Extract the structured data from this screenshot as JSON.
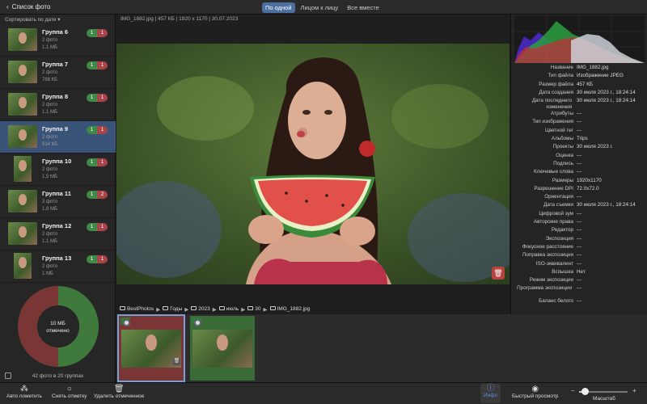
{
  "topbar": {
    "back_label": "Список фото",
    "view_modes": [
      {
        "label": "По одной",
        "active": true
      },
      {
        "label": "Лицом к лицу",
        "active": false
      },
      {
        "label": "Все вместе",
        "active": false
      }
    ]
  },
  "sidebar": {
    "sort_label": "Сортировать по дате",
    "groups": [
      {
        "name": "Группа 6",
        "count": "2 фото",
        "size": "1,1 МБ",
        "keep": "1",
        "discard": "1",
        "selected": false
      },
      {
        "name": "Группа 7",
        "count": "2 фото",
        "size": "768 КБ",
        "keep": "1",
        "discard": "1",
        "selected": false
      },
      {
        "name": "Группа 8",
        "count": "2 фото",
        "size": "1,1 МБ",
        "keep": "1",
        "discard": "1",
        "selected": false
      },
      {
        "name": "Группа 9",
        "count": "2 фото",
        "size": "914 КБ",
        "keep": "1",
        "discard": "1",
        "selected": true
      },
      {
        "name": "Группа 10",
        "count": "2 фото",
        "size": "1,5 МБ",
        "keep": "1",
        "discard": "1",
        "selected": false
      },
      {
        "name": "Группа 11",
        "count": "3 фото",
        "size": "1,8 МБ",
        "keep": "1",
        "discard": "2",
        "selected": false
      },
      {
        "name": "Группа 12",
        "count": "2 фото",
        "size": "1,1 МБ",
        "keep": "1",
        "discard": "1",
        "selected": false
      },
      {
        "name": "Группа 13",
        "count": "2 фото",
        "size": "1 МБ",
        "keep": "1",
        "discard": "1",
        "selected": false
      }
    ],
    "donut": {
      "marked_size": "10 МБ",
      "marked_label": "отмечено",
      "marked_fraction": 0.5,
      "colors": {
        "marked": "#7a3535",
        "kept": "#3f7a3c"
      }
    },
    "summary": "42 фото в 20 группах"
  },
  "viewer": {
    "fileinfo": "IMG_1882.jpg | 457 КБ | 1920 x 1170 | 30.07.2023"
  },
  "breadcrumb": [
    "BestPhotos",
    "Годы",
    "2023",
    "июль",
    "30",
    "IMG_1882.jpg"
  ],
  "filmstrip": [
    {
      "state": "discard",
      "selected": true
    },
    {
      "state": "keep",
      "selected": false
    }
  ],
  "metadata": [
    {
      "key": "Название",
      "value": "IMG_1882.jpg"
    },
    {
      "key": "Тип файла",
      "value": "Изображение JPEG"
    },
    {
      "key": "Размер файла",
      "value": "457 КБ"
    },
    {
      "key": "Дата создания",
      "value": "30 июля 2023 г., 18:24:14"
    },
    {
      "key": "Дата последнего изменения",
      "value": "30 июля 2023 г., 18:24:14"
    },
    {
      "key": "Атрибуты",
      "value": "---"
    },
    {
      "key": "Тип изображения",
      "value": "---"
    },
    {
      "key": "Цветной тег",
      "value": "---"
    },
    {
      "key": "Альбомы",
      "value": "Trips"
    },
    {
      "key": "Проекты",
      "value": "30 июля 2023 г."
    },
    {
      "key": "Оценка",
      "value": "---"
    },
    {
      "key": "Подпись",
      "value": "---"
    },
    {
      "key": "Ключевые слова",
      "value": "---"
    },
    {
      "key": "Размеры",
      "value": "1920x1170"
    },
    {
      "key": "Разрешение DPI",
      "value": "72.0x72.0"
    },
    {
      "key": "Ориентация",
      "value": "---"
    },
    {
      "key": "Дата съемки",
      "value": "30 июля 2023 г., 18:24:14"
    },
    {
      "key": "Цифровой зум",
      "value": "---"
    },
    {
      "key": "Авторские права",
      "value": "---"
    },
    {
      "key": "Редактор",
      "value": "---"
    },
    {
      "key": "Экспозиция",
      "value": "---"
    },
    {
      "key": "Фокусное расстояние",
      "value": "---"
    },
    {
      "key": "Поправка экспозиции",
      "value": "---"
    },
    {
      "key": "ISO-эквивалент",
      "value": "---"
    },
    {
      "key": "Вспышка",
      "value": "Нет"
    },
    {
      "key": "Режим экспозиции",
      "value": "---"
    },
    {
      "key": "Программа экспозиции",
      "value": "---"
    },
    {
      "key": "Баланс белого",
      "value": "---"
    }
  ],
  "toolbar": {
    "auto_mark": "Авто пометить",
    "unmark": "Снять отметку",
    "delete_marked": "Удалить отмеченное",
    "info": "Инфо",
    "quick_look": "Быстрый просмотр",
    "zoom_label": "Масштаб",
    "zoom_level": 0.12
  }
}
